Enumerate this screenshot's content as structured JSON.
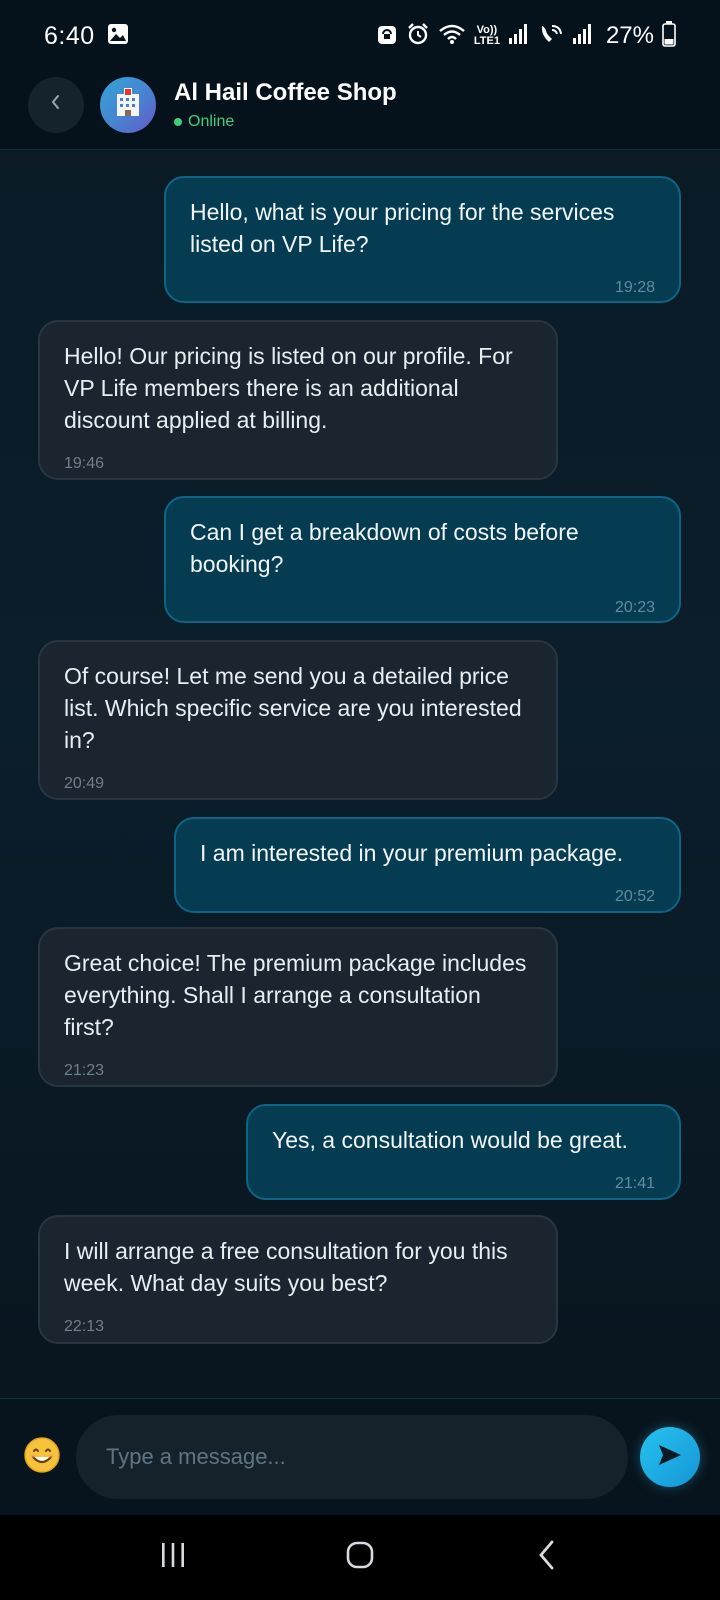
{
  "status_bar": {
    "time": "6:40",
    "battery": "27%",
    "lte_top": "Vo))",
    "lte_bottom": "LTE1"
  },
  "header": {
    "contact_name": "Al Hail Coffee Shop",
    "contact_status": "Online"
  },
  "messages": [
    {
      "direction": "out",
      "text": "Hello, what is your pricing for the services listed on VP Life?",
      "time": "19:28"
    },
    {
      "direction": "in",
      "text": "Hello! Our pricing is listed on our profile. For VP Life members there is an additional discount applied at billing.",
      "time": "19:46"
    },
    {
      "direction": "out",
      "text": "Can I get a breakdown of costs before booking?",
      "time": "20:23"
    },
    {
      "direction": "in",
      "text": "Of course! Let me send you a detailed price list. Which specific service are you interested in?",
      "time": "20:49"
    },
    {
      "direction": "out",
      "text": "I am interested in your premium package.",
      "time": "20:52"
    },
    {
      "direction": "in",
      "text": "Great choice! The premium package includes everything. Shall I arrange a consultation first?",
      "time": "21:23"
    },
    {
      "direction": "out",
      "text": "Yes, a consultation would be great.",
      "time": "21:41"
    },
    {
      "direction": "in",
      "text": "I will arrange a free consultation for you this week. What day suits you best?",
      "time": "22:13"
    }
  ],
  "composer": {
    "placeholder": "Type a message...",
    "value": ""
  },
  "colors": {
    "outgoing_bubble": "#053c52",
    "incoming_bubble": "#1a2530",
    "online": "#3ecf7a",
    "send_button": "#1ea9e2"
  },
  "icons": {
    "back": "chevron-left-icon",
    "avatar": "hotel-building-icon",
    "emoji": "smiley-icon",
    "send": "send-arrow-icon",
    "nav_recents": "recents-icon",
    "nav_home": "home-icon",
    "nav_back": "back-icon"
  }
}
